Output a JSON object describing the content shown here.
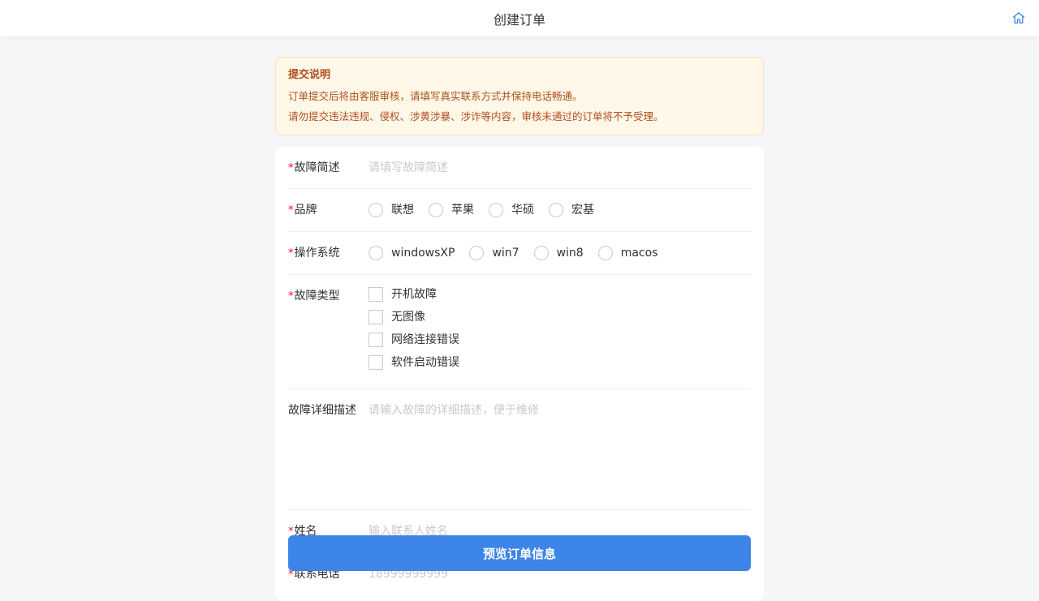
{
  "header": {
    "title": "创建订单",
    "home_icon": "home-icon"
  },
  "notice": {
    "title": "提交说明",
    "line1": "订单提交后将由客服审核，请填写真实联系方式并保持电话畅通。",
    "line2": "请勿提交违法违规、侵权、涉黄涉暴、涉诈等内容，审核未通过的订单将不予受理。"
  },
  "form": {
    "required_mark": "*",
    "fault_summary": {
      "label": "故障简述",
      "placeholder": "请填写故障简述"
    },
    "brand": {
      "label": "品牌",
      "options": [
        "联想",
        "苹果",
        "华硕",
        "宏基"
      ]
    },
    "os": {
      "label": "操作系统",
      "options": [
        "windowsXP",
        "win7",
        "win8",
        "macos"
      ]
    },
    "fault_type": {
      "label": "故障类型",
      "options": [
        "开机故障",
        "无图像",
        "网络连接错误",
        "软件启动错误"
      ]
    },
    "fault_detail": {
      "label": "故障详细描述",
      "placeholder": "请输入故障的详细描述，便于维修"
    },
    "name": {
      "label": "姓名",
      "placeholder": "输入联系人姓名"
    },
    "phone": {
      "label": "联系电话",
      "placeholder": "18999999999"
    }
  },
  "submit_label": "预览订单信息",
  "colors": {
    "accent": "#3d85e6",
    "required": "#ee0a24",
    "notice_text": "#b0501f",
    "notice_bg": "#fff7e8"
  }
}
